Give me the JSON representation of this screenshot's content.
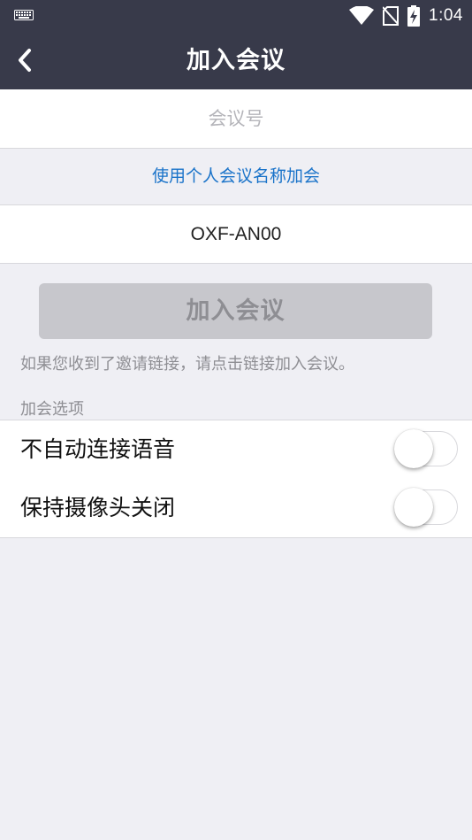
{
  "status_bar": {
    "time": "1:04",
    "icons": [
      "keyboard-icon",
      "wifi-icon",
      "no-sim-icon",
      "battery-charging-icon"
    ]
  },
  "nav": {
    "title": "加入会议",
    "back_icon": "chevron-left-icon"
  },
  "form": {
    "meeting_id_placeholder": "会议号",
    "meeting_id_value": "",
    "personal_link_text": "使用个人会议名称加会",
    "display_name_value": "OXF-AN00"
  },
  "join_button": {
    "label": "加入会议",
    "enabled": false
  },
  "hint_text": "如果您收到了邀请链接，请点击链接加入会议。",
  "options": {
    "section_label": "加会选项",
    "items": [
      {
        "label": "不自动连接语音",
        "on": false
      },
      {
        "label": "保持摄像头关闭",
        "on": false
      }
    ]
  },
  "colors": {
    "header_bg": "#383a4a",
    "page_bg": "#efeff4",
    "link": "#1a73c9",
    "disabled_button_bg": "#c7c7cc",
    "disabled_button_text": "#8e8e93"
  }
}
